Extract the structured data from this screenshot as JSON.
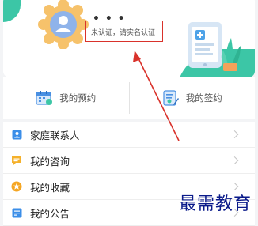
{
  "profile": {
    "name": "• • •",
    "verify_text": "未认证，请实名认证"
  },
  "quick_actions": [
    {
      "label": "我的预约",
      "icon": "calendar-icon"
    },
    {
      "label": "我的签约",
      "icon": "contract-icon"
    }
  ],
  "menu": [
    {
      "label": "家庭联系人",
      "icon": "contact-icon",
      "color": "#3b8ee8"
    },
    {
      "label": "我的咨询",
      "icon": "chat-icon",
      "color": "#f5b12b"
    },
    {
      "label": "我的收藏",
      "icon": "star-icon",
      "color": "#f5a623"
    },
    {
      "label": "我的公告",
      "icon": "announcement-icon",
      "color": "#3b8ee8"
    }
  ],
  "watermark": "最需教育",
  "colors": {
    "accent": "#3cc6a6",
    "annotation": "#d9322b",
    "avatar_ring": "#f6c26b"
  }
}
